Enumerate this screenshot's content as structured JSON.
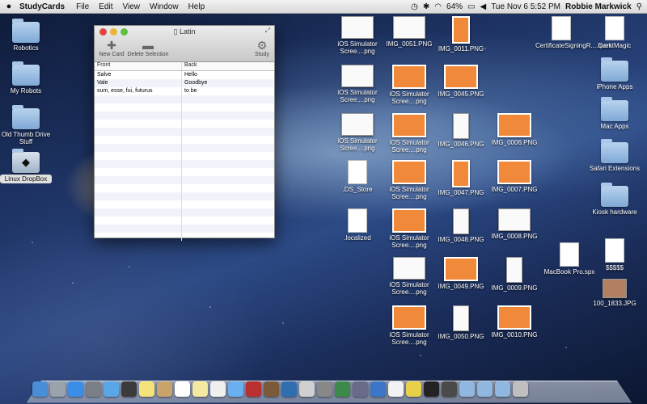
{
  "menubar": {
    "apple": "",
    "app_name": "StudyCards",
    "menus": [
      "File",
      "Edit",
      "View",
      "Window",
      "Help"
    ],
    "battery": "64%",
    "datetime": "Tue Nov 6  5:52 PM",
    "user": "Robbie Markwick"
  },
  "window": {
    "title": "Latin",
    "toolbar": {
      "new_card": "New Card",
      "delete_selection": "Delete Selection",
      "study": "Study"
    },
    "columns": {
      "front": "Front",
      "back": "Back"
    },
    "rows": [
      {
        "front": "Salve",
        "back": "Hello"
      },
      {
        "front": "Vale",
        "back": "Goodbye"
      },
      {
        "front": "sum, esse, fui, futurus",
        "back": "to be"
      }
    ],
    "empty_rows": 18
  },
  "left_icons": [
    {
      "label": "Robotics",
      "kind": "folder"
    },
    {
      "label": "My Robots",
      "kind": "folder"
    },
    {
      "label": "Old Thumb Drive Stuff",
      "kind": "folder"
    },
    {
      "label": "Linux DropBox",
      "kind": "folder",
      "selected": true
    }
  ],
  "right_icons": [
    {
      "label": "CertificateSigningR....quest",
      "kind": "doc"
    },
    {
      "label": "Dark Magic",
      "kind": "doc"
    },
    {
      "label": "iPhone Apps",
      "kind": "folder"
    },
    {
      "label": "Mac Apps",
      "kind": "folder"
    },
    {
      "label": "Safari Extensions",
      "kind": "folder"
    },
    {
      "label": "Kiosk hardware",
      "kind": "folder"
    },
    {
      "label": "MacBook Pro.spx",
      "kind": "doc"
    },
    {
      "label": "$$$$$",
      "kind": "doc"
    },
    {
      "label": "100_1833.JPG",
      "kind": "image"
    }
  ],
  "grid_icons": [
    {
      "label": "iOS Simulator Scree....png",
      "kind": "white"
    },
    {
      "label": "IMG_0051.PNG",
      "kind": "white"
    },
    {
      "label": "IMG_0011.PNG",
      "kind": "orange"
    },
    {
      "label": "iOS Simulator Scree....png",
      "kind": "white"
    },
    {
      "label": "iOS Simulator Scree....png",
      "kind": "orange"
    },
    {
      "label": "IMG_0045.PNG",
      "kind": "orange"
    },
    {
      "label": "iOS Simulator Scree....png",
      "kind": "white"
    },
    {
      "label": "iOS Simulator Scree....png",
      "kind": "orange"
    },
    {
      "label": "IMG_0046.PNG",
      "kind": "white"
    },
    {
      "label": "IMG_0006.PNG",
      "kind": "orange"
    },
    {
      "label": ".DS_Store",
      "kind": "doc"
    },
    {
      "label": "iOS Simulator Scree....png",
      "kind": "orange"
    },
    {
      "label": "IMG_0047.PNG",
      "kind": "orange"
    },
    {
      "label": "IMG_0007.PNG",
      "kind": "orange"
    },
    {
      "label": ".localized",
      "kind": "doc"
    },
    {
      "label": "iOS Simulator Scree....png",
      "kind": "orange"
    },
    {
      "label": "IMG_0048.PNG",
      "kind": "white"
    },
    {
      "label": "IMG_0008.PNG",
      "kind": "white"
    },
    {
      "label": "iOS Simulator Scree....png",
      "kind": "white"
    },
    {
      "label": "IMG_0049.PNG",
      "kind": "orange"
    },
    {
      "label": "IMG_0009.PNG",
      "kind": "white"
    },
    {
      "label": "iOS Simulator Scree....png",
      "kind": "orange"
    },
    {
      "label": "IMG_0050.PNG",
      "kind": "white"
    },
    {
      "label": "IMG_0010.PNG",
      "kind": "orange"
    }
  ],
  "dock": {
    "apps": [
      "finder",
      "launchpad",
      "app-store",
      "system-preferences",
      "messages",
      "facetime",
      "stickies",
      "contacts",
      "calendar",
      "notes",
      "reminders",
      "itunes",
      "photo-booth",
      "photos",
      "iphoto",
      "preview",
      "screenshot",
      "time-machine",
      "script-editor",
      "xcode",
      "textedit",
      "chrome",
      "terminal",
      "grapher",
      "documents-folder",
      "downloads-folder",
      "applications-folder",
      "trash"
    ],
    "colors": [
      "#4a8fd6",
      "#9aa2ac",
      "#3a8ee6",
      "#7a7f86",
      "#5aa7e8",
      "#3b3b3b",
      "#f5e27a",
      "#c9a46a",
      "#ffffff",
      "#f3e9a0",
      "#f0f0f0",
      "#6ab0f0",
      "#b83030",
      "#7a5a3a",
      "#2f6fb0",
      "#d0d0d0",
      "#888888",
      "#3c8a4a",
      "#6a6a8a",
      "#3d76c9",
      "#f2f2f2",
      "#e8d04a",
      "#222222",
      "#4a4a4a",
      "#8fb7e0",
      "#8fb7e0",
      "#8fb7e0",
      "#bfbfbf"
    ]
  }
}
